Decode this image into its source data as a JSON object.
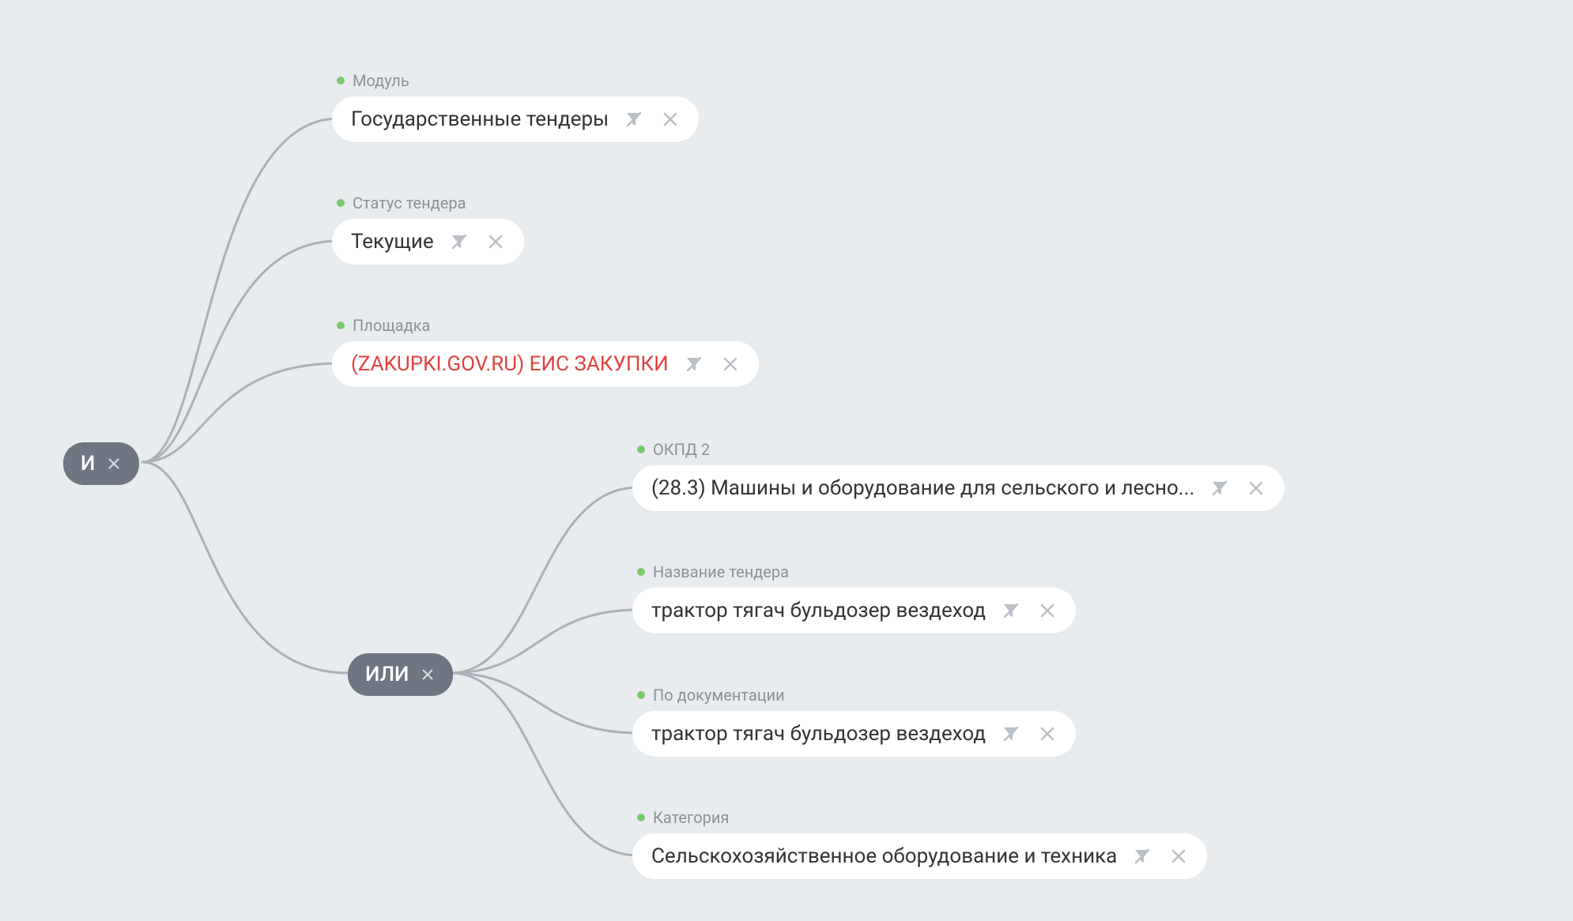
{
  "operators": {
    "root": {
      "label": "И"
    },
    "or": {
      "label": "ИЛИ"
    }
  },
  "filters": {
    "module": {
      "label": "Модуль",
      "value": "Государственные тендеры"
    },
    "status": {
      "label": "Статус тендера",
      "value": "Текущие"
    },
    "platform": {
      "label": "Площадка",
      "value": "(ZAKUPKI.GOV.RU) ЕИС ЗАКУПКИ"
    },
    "okpd": {
      "label": "ОКПД 2",
      "value": "(28.3) Машины и оборудование для сельского и лесно..."
    },
    "name": {
      "label": "Название тендера",
      "value": "трактор тягач бульдозер вездеход"
    },
    "docs": {
      "label": "По документации",
      "value": "трактор тягач бульдозер вездеход"
    },
    "category": {
      "label": "Категория",
      "value": "Сельскохозяйственное оборудование и техника"
    }
  },
  "colors": {
    "node_bg": "#6e7681",
    "connector": "#aab1b8",
    "dot": "#7bc96f",
    "red_text": "#e0423f",
    "icon": "#b9bfc5",
    "bg": "#e9ecef"
  }
}
